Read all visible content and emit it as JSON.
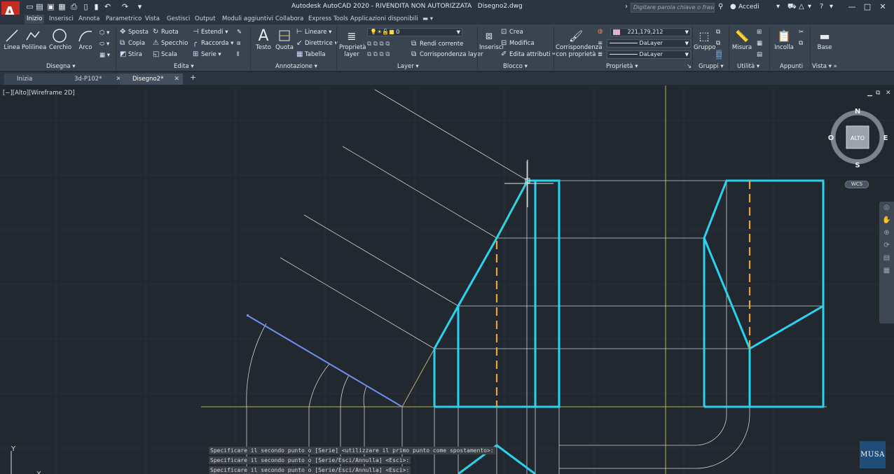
{
  "window": {
    "title": "Autodesk AutoCAD 2020 - RIVENDITA NON AUTORIZZATA",
    "document": "Disegno2.dwg",
    "search_placeholder": "Digitare parola chiave o frase",
    "signin": "Accedi"
  },
  "ribbon_tabs": [
    "Inizio",
    "Inserisci",
    "Annota",
    "Parametrico",
    "Vista",
    "Gestisci",
    "Output",
    "Moduli aggiuntivi",
    "Collabora",
    "Express Tools",
    "Applicazioni disponibili"
  ],
  "panels": {
    "disegna": {
      "label": "Disegna",
      "tools": [
        "Linea",
        "Polilinea",
        "Cerchio",
        "Arco"
      ]
    },
    "edita": {
      "label": "Edita",
      "col1": [
        "Sposta",
        "Copia",
        "Stira"
      ],
      "col2": [
        "Ruota",
        "Specchio",
        "Scala"
      ],
      "col3": [
        "Estendi",
        "Raccorda",
        "Serie"
      ]
    },
    "annotazione": {
      "label": "Annotazione",
      "big": [
        "Testo",
        "Quota"
      ],
      "small": [
        "Lineare",
        "Direttrice",
        "Tabella"
      ]
    },
    "layer": {
      "label": "Layer",
      "big": "Proprietà layer",
      "current_layer": "0",
      "small": [
        "Rendi corrente",
        "Corrispondenza layer"
      ]
    },
    "blocco": {
      "label": "Blocco",
      "big": "Inserisci",
      "small": [
        "Crea",
        "Modifica",
        "Edita attributi"
      ]
    },
    "proprieta": {
      "label": "Proprietà",
      "big": "Corrispondenza con proprietà",
      "color_value": "221,179,212",
      "linetype": "DaLayer",
      "lineweight": "DaLayer"
    },
    "gruppi": {
      "label": "Gruppi",
      "big": "Gruppo"
    },
    "utilita": {
      "label": "Utilità",
      "big": "Misura"
    },
    "appunti": {
      "label": "Appunti",
      "big": "Incolla"
    },
    "vista": {
      "label": "Vista",
      "big": "Base"
    }
  },
  "doc_tabs": [
    "Inizia",
    "3d-P102*",
    "Disegno2*"
  ],
  "viewport": {
    "label": "[−][Alto][Wireframe 2D]",
    "viewcube": {
      "n": "N",
      "s": "S",
      "e": "E",
      "o": "O",
      "face": "ALTO"
    },
    "wcs": "WCS"
  },
  "command_lines": [
    "Specificare il secondo punto o [Serie] <utilizzare il primo punto come spostamento>:",
    "Specificare il secondo punto o [Serie/Esci/Annulla] <Esci>:",
    "Specificare il secondo punto o [Serie/Esci/Annulla] <Esci>:"
  ],
  "ucs": {
    "y": "Y",
    "x": "X"
  },
  "watermark": "MUSA",
  "colors": {
    "accent_cyan": "#29d3ee",
    "hidden_orange": "#e8a43a",
    "selected_blue": "#6f8ff0",
    "background": "#212830",
    "app_red": "#d8322a"
  }
}
